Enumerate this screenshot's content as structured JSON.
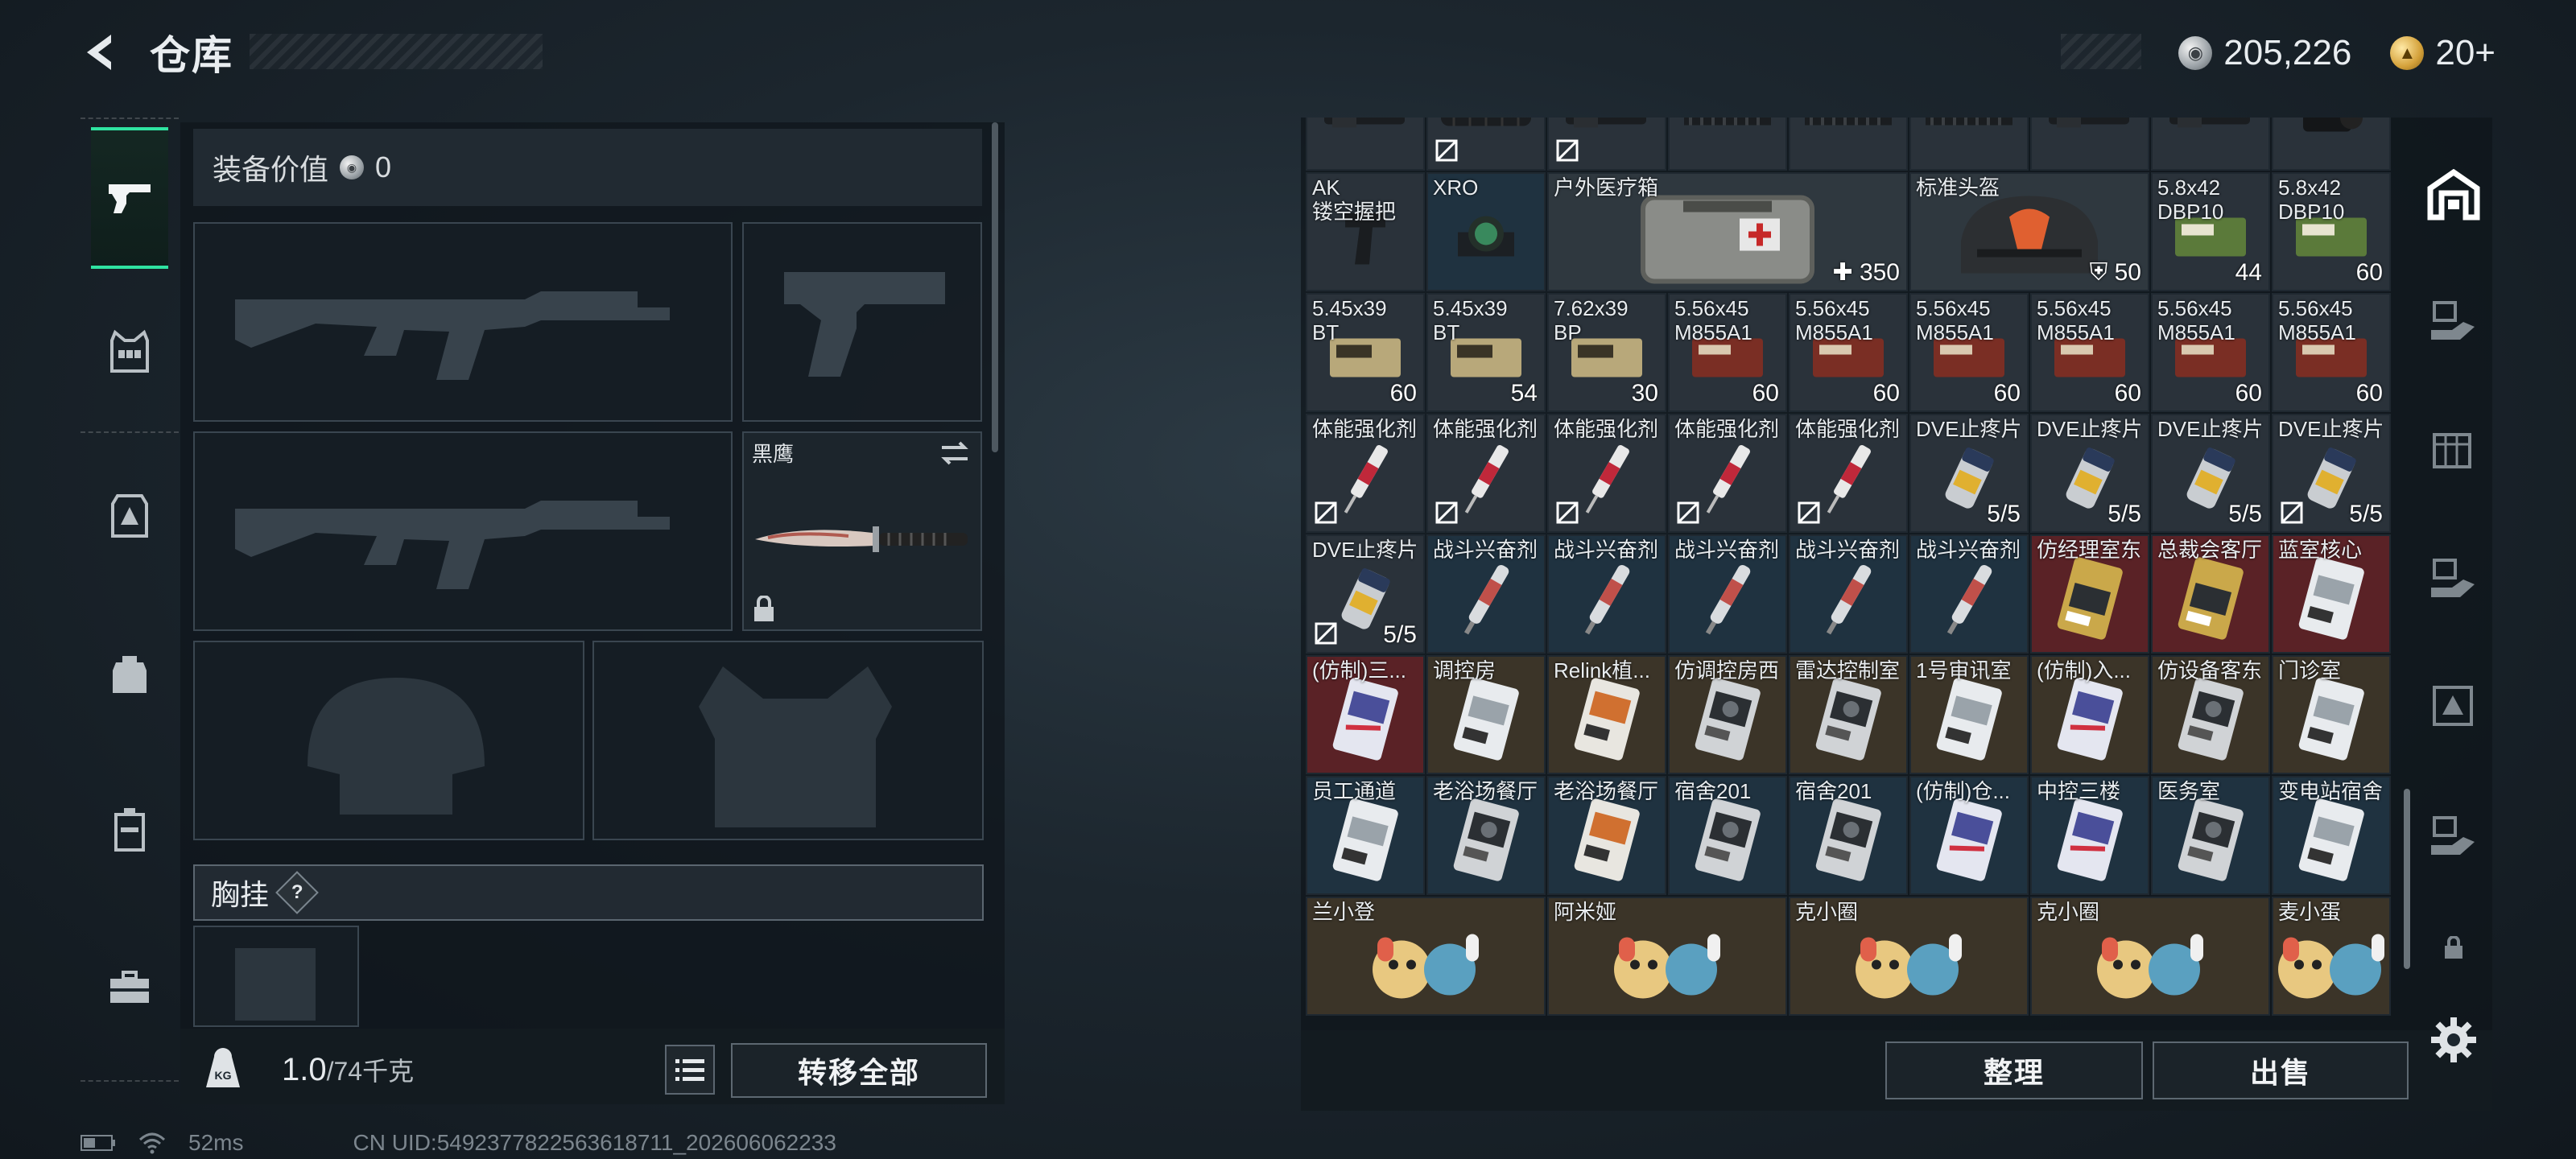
{
  "header": {
    "title": "仓库",
    "currency_silver": "205,226",
    "currency_gold": "20+"
  },
  "equipment": {
    "value_label": "装备价值",
    "value": "0",
    "melee_name": "黑鹰",
    "chest_label": "胸挂",
    "chest_help": "?",
    "weight_current": "1.0",
    "weight_max": "/74千克",
    "transfer_all": "转移全部"
  },
  "inventory": {
    "rows": [
      {
        "cells": [
          {
            "name": "",
            "count": "",
            "bg": "dark",
            "art": "muzzle",
            "no_trade": false
          },
          {
            "name": "",
            "count": "",
            "bg": "dark",
            "art": "suppressor",
            "no_trade": true
          },
          {
            "name": "",
            "count": "",
            "bg": "dark",
            "art": "muzzle",
            "no_trade": true
          },
          {
            "name": "",
            "count": "",
            "bg": "dark",
            "art": "rail",
            "no_trade": false
          },
          {
            "name": "",
            "count": "",
            "bg": "dark",
            "art": "rail",
            "no_trade": false
          },
          {
            "name": "",
            "count": "",
            "bg": "dark",
            "art": "rail",
            "no_trade": false
          },
          {
            "name": "",
            "count": "",
            "bg": "dark",
            "art": "muzzle",
            "no_trade": false
          },
          {
            "name": "",
            "count": "",
            "bg": "dark",
            "art": "muzzle",
            "no_trade": false
          },
          {
            "name": "",
            "count": "",
            "bg": "dark",
            "art": "scope",
            "no_trade": false
          }
        ]
      },
      {
        "cells": [
          {
            "name": "AK\n镂空握把",
            "count": "",
            "bg": "dark",
            "art": "grip",
            "no_trade": false
          },
          {
            "name": "XRO",
            "count": "",
            "bg": "blue",
            "art": "sight",
            "no_trade": false
          },
          {
            "name": "户外医疗箱",
            "count": "350",
            "bg": "bigdark",
            "art": "medkit",
            "no_trade": false,
            "wide": 3,
            "count_icon": "plus"
          },
          {
            "name": "标准头盔",
            "count": "50",
            "bg": "bigdark",
            "art": "helmet",
            "no_trade": false,
            "wide": 2,
            "count_icon": "shield"
          },
          {
            "name": "5.8x42\nDBP10",
            "count": "44",
            "bg": "dark",
            "art": "ammo-green",
            "no_trade": false
          },
          {
            "name": "5.8x42\nDBP10",
            "count": "60",
            "bg": "dark",
            "art": "ammo-green",
            "no_trade": false
          }
        ]
      },
      {
        "cells": [
          {
            "name": "5.45x39\nBT",
            "count": "60",
            "bg": "dark",
            "art": "ammo-tan",
            "no_trade": false
          },
          {
            "name": "5.45x39\nBT",
            "count": "54",
            "bg": "dark",
            "art": "ammo-tan",
            "no_trade": false
          },
          {
            "name": "7.62x39\nBP",
            "count": "30",
            "bg": "dark",
            "art": "ammo-tan",
            "no_trade": false
          },
          {
            "name": "5.56x45\nM855A1",
            "count": "60",
            "bg": "dark",
            "art": "ammo-red",
            "no_trade": false
          },
          {
            "name": "5.56x45\nM855A1",
            "count": "60",
            "bg": "dark",
            "art": "ammo-red",
            "no_trade": false
          },
          {
            "name": "5.56x45\nM855A1",
            "count": "60",
            "bg": "dark",
            "art": "ammo-red",
            "no_trade": false
          },
          {
            "name": "5.56x45\nM855A1",
            "count": "60",
            "bg": "dark",
            "art": "ammo-red",
            "no_trade": false
          },
          {
            "name": "5.56x45\nM855A1",
            "count": "60",
            "bg": "dark",
            "art": "ammo-red",
            "no_trade": false
          },
          {
            "name": "5.56x45\nM855A1",
            "count": "60",
            "bg": "dark",
            "art": "ammo-red",
            "no_trade": false
          }
        ]
      },
      {
        "cells": [
          {
            "name": "体能强化剂",
            "count": "",
            "bg": "dark",
            "art": "syringe-red",
            "no_trade": true
          },
          {
            "name": "体能强化剂",
            "count": "",
            "bg": "dark",
            "art": "syringe-red",
            "no_trade": true
          },
          {
            "name": "体能强化剂",
            "count": "",
            "bg": "dark",
            "art": "syringe-red",
            "no_trade": true
          },
          {
            "name": "体能强化剂",
            "count": "",
            "bg": "dark",
            "art": "syringe-red",
            "no_trade": true
          },
          {
            "name": "体能强化剂",
            "count": "",
            "bg": "dark",
            "art": "syringe-red",
            "no_trade": true
          },
          {
            "name": "DVE止疼片",
            "count": "5/5",
            "bg": "dark",
            "art": "pills",
            "no_trade": false
          },
          {
            "name": "DVE止疼片",
            "count": "5/5",
            "bg": "dark",
            "art": "pills",
            "no_trade": false
          },
          {
            "name": "DVE止疼片",
            "count": "5/5",
            "bg": "dark",
            "art": "pills",
            "no_trade": false
          },
          {
            "name": "DVE止疼片",
            "count": "5/5",
            "bg": "dark",
            "art": "pills",
            "no_trade": true
          }
        ]
      },
      {
        "cells": [
          {
            "name": "DVE止疼片",
            "count": "5/5",
            "bg": "dark",
            "art": "pills",
            "no_trade": true
          },
          {
            "name": "战斗兴奋剂",
            "count": "",
            "bg": "blue",
            "art": "injector",
            "no_trade": false
          },
          {
            "name": "战斗兴奋剂",
            "count": "",
            "bg": "blue",
            "art": "injector",
            "no_trade": false
          },
          {
            "name": "战斗兴奋剂",
            "count": "",
            "bg": "blue",
            "art": "injector",
            "no_trade": false
          },
          {
            "name": "战斗兴奋剂",
            "count": "",
            "bg": "blue",
            "art": "injector",
            "no_trade": false
          },
          {
            "name": "战斗兴奋剂",
            "count": "",
            "bg": "blue",
            "art": "injector",
            "no_trade": false
          },
          {
            "name": "仿经理室东",
            "count": "",
            "bg": "red",
            "art": "card-gold",
            "no_trade": false
          },
          {
            "name": "总裁会客厅",
            "count": "",
            "bg": "red",
            "art": "card-gold",
            "no_trade": false
          },
          {
            "name": "蓝室核心",
            "count": "",
            "bg": "red",
            "art": "card-white",
            "no_trade": false
          }
        ]
      },
      {
        "cells": [
          {
            "name": "(仿制)三...",
            "count": "",
            "bg": "red",
            "art": "card-blue",
            "no_trade": false
          },
          {
            "name": "调控房",
            "count": "",
            "bg": "brown",
            "art": "card-white",
            "no_trade": false
          },
          {
            "name": "Relink植...",
            "count": "",
            "bg": "brown",
            "art": "card-orange",
            "no_trade": false
          },
          {
            "name": "仿调控房西",
            "count": "",
            "bg": "brown",
            "art": "card-dark",
            "no_trade": false
          },
          {
            "name": "雷达控制室",
            "count": "",
            "bg": "brown",
            "art": "card-dark",
            "no_trade": false
          },
          {
            "name": "1号审讯室",
            "count": "",
            "bg": "brown",
            "art": "card-white",
            "no_trade": false
          },
          {
            "name": "(仿制)入...",
            "count": "",
            "bg": "brown",
            "art": "card-blue",
            "no_trade": false
          },
          {
            "name": "仿设备客东",
            "count": "",
            "bg": "brown",
            "art": "card-dark",
            "no_trade": false
          },
          {
            "name": "门诊室",
            "count": "",
            "bg": "brown",
            "art": "card-white",
            "no_trade": false
          }
        ]
      },
      {
        "cells": [
          {
            "name": "员工通道",
            "count": "",
            "bg": "blue",
            "art": "card-white",
            "no_trade": false
          },
          {
            "name": "老浴场餐厅",
            "count": "",
            "bg": "blue",
            "art": "card-dark",
            "no_trade": false
          },
          {
            "name": "老浴场餐厅",
            "count": "",
            "bg": "blue",
            "art": "card-orange",
            "no_trade": false
          },
          {
            "name": "宿舍201",
            "count": "",
            "bg": "blue",
            "art": "card-dark",
            "no_trade": false
          },
          {
            "name": "宿舍201",
            "count": "",
            "bg": "blue",
            "art": "card-dark",
            "no_trade": false
          },
          {
            "name": "(仿制)仓...",
            "count": "",
            "bg": "blue",
            "art": "card-blue",
            "no_trade": false
          },
          {
            "name": "中控三楼",
            "count": "",
            "bg": "blue",
            "art": "card-blue",
            "no_trade": false
          },
          {
            "name": "医务室",
            "count": "",
            "bg": "blue",
            "art": "card-dark",
            "no_trade": false
          },
          {
            "name": "变电站宿舍",
            "count": "",
            "bg": "blue",
            "art": "card-white",
            "no_trade": false
          }
        ]
      },
      {
        "cells": [
          {
            "name": "兰小登",
            "count": "",
            "bg": "brown",
            "art": "toy",
            "no_trade": false,
            "wide": 2
          },
          {
            "name": "阿米娅",
            "count": "",
            "bg": "brown",
            "art": "toy",
            "no_trade": false,
            "wide": 2
          },
          {
            "name": "克小圈",
            "count": "",
            "bg": "brown",
            "art": "toy",
            "no_trade": false,
            "wide": 2
          },
          {
            "name": "克小圈",
            "count": "",
            "bg": "brown",
            "art": "toy",
            "no_trade": false,
            "wide": 2
          },
          {
            "name": "麦小蛋",
            "count": "",
            "bg": "brown",
            "art": "toy",
            "no_trade": false
          }
        ]
      }
    ],
    "sort_label": "整理",
    "sell_label": "出售"
  },
  "status": {
    "ping": "52ms",
    "uid": "CN UID:5492377822563618711_202606062233"
  }
}
